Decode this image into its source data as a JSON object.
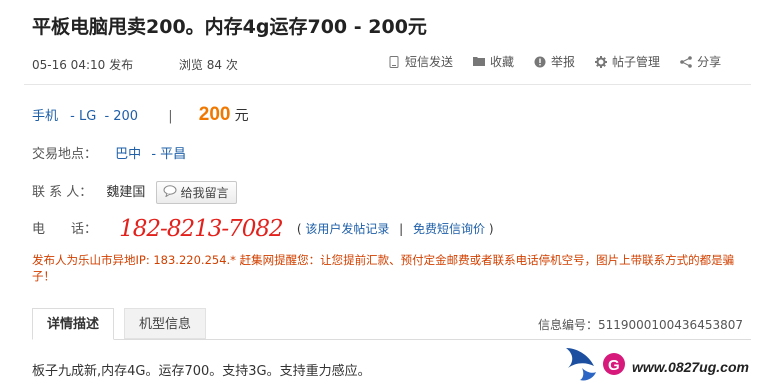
{
  "title": "平板电脑甩卖200。内存4g运存700 - 200元",
  "meta": {
    "posted": "05-16 04:10 发布",
    "views_label": "浏览",
    "views_count": "84 次"
  },
  "actions": [
    {
      "icon": "phone-icon",
      "label": "短信发送"
    },
    {
      "icon": "folder-icon",
      "label": "收藏"
    },
    {
      "icon": "warning-icon",
      "label": "举报"
    },
    {
      "icon": "gear-icon",
      "label": "帖子管理"
    },
    {
      "icon": "share-icon",
      "label": "分享"
    }
  ],
  "category": {
    "cat1": "手机",
    "cat2": "- LG",
    "cat3": "- 200",
    "separator": "|",
    "price": "200",
    "unit": "元"
  },
  "location": {
    "label": "交易地点：",
    "region": "巴中",
    "district": "- 平昌"
  },
  "contact": {
    "label": "联 系 人：",
    "name": "魏建国",
    "button": "给我留言"
  },
  "phone": {
    "label": "电　　话：",
    "number": "182-8213-7082",
    "open_paren": "(",
    "history_link": "该用户发帖记录",
    "separator": "|",
    "sms_link": "免费短信询价",
    "close_paren": ")"
  },
  "warning": "发布人为乐山市异地IP: 183.220.254.* 赶集网提醒您：让您提前汇款、预付定金邮费或者联系电话停机空号，图片上带联系方式的都是骗子！",
  "tabs": [
    {
      "label": "详情描述"
    },
    {
      "label": "机型信息"
    }
  ],
  "info_number": "信息编号：5119000100436453807",
  "description": "板子九成新,内存4G。运存700。支持3G。支持重力感应。",
  "watermark_text": "www.0827ug.com",
  "colors": {
    "price": "#f07800",
    "phone": "#e3211c",
    "link": "#1e5fa8",
    "warning": "#d24000"
  }
}
